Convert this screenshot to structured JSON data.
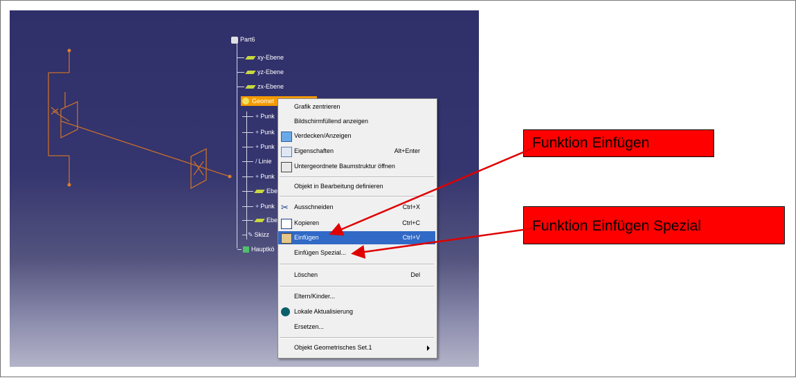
{
  "tree": {
    "root": "Part6",
    "planes": [
      "xy-Ebene",
      "yz-Ebene",
      "zx-Ebene"
    ],
    "geometric_set": "Geomet",
    "children": [
      "Punk",
      "Punk",
      "Punk",
      "Linie",
      "Punk",
      "Eben",
      "Punk",
      "Eben",
      "Skizz"
    ],
    "main_body": "Hauptkö"
  },
  "context_menu": {
    "items": [
      {
        "label": "Grafik zentrieren",
        "shortcut": "",
        "icon": ""
      },
      {
        "label": "Bildschirmfüllend anzeigen",
        "shortcut": "",
        "icon": ""
      },
      {
        "label": "Verdecken/Anzeigen",
        "shortcut": "",
        "icon": "hide-show-icon"
      },
      {
        "label": "Eigenschaften",
        "shortcut": "Alt+Enter",
        "icon": "properties-icon"
      },
      {
        "label": "Untergeordnete Baumstruktur öffnen",
        "shortcut": "",
        "icon": "tree-icon"
      },
      {
        "label": "Objekt in Bearbeitung definieren",
        "shortcut": "",
        "icon": ""
      },
      {
        "label": "Ausschneiden",
        "shortcut": "Ctrl+X",
        "icon": "scissors-icon"
      },
      {
        "label": "Kopieren",
        "shortcut": "Ctrl+C",
        "icon": "copy-icon"
      },
      {
        "label": "Einfügen",
        "shortcut": "Ctrl+V",
        "icon": "paste-icon"
      },
      {
        "label": "Einfügen Spezial...",
        "shortcut": "",
        "icon": ""
      },
      {
        "label": "Löschen",
        "shortcut": "Del",
        "icon": ""
      },
      {
        "label": "Eltern/Kinder...",
        "shortcut": "",
        "icon": ""
      },
      {
        "label": "Lokale Aktualisierung",
        "shortcut": "",
        "icon": "local-update-icon"
      },
      {
        "label": "Ersetzen...",
        "shortcut": "",
        "icon": ""
      },
      {
        "label": "Objekt Geometrisches Set.1",
        "shortcut": "",
        "icon": ""
      }
    ],
    "selected_index": 8
  },
  "callouts": {
    "paste": "Funktion Einfügen",
    "paste_special": "Funktion Einfügen Spezial"
  },
  "colors": {
    "viewport_top": "#2f2f6a",
    "geometry": "#d2691e",
    "highlight": "#f59a00",
    "menu_selection": "#3169c6",
    "callout": "#ff0000"
  }
}
